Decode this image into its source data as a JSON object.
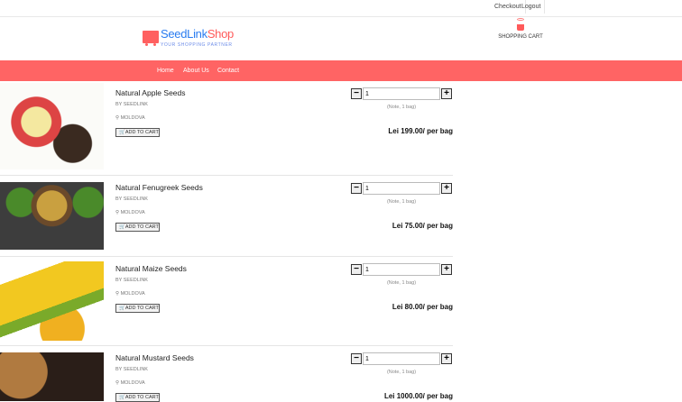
{
  "topbar": {
    "checkout": "Checkout",
    "logout": "Logout"
  },
  "brand": {
    "part1": "SeedLink",
    "part2": "Shop",
    "tagline": "YOUR SHOPPING PARTNER"
  },
  "cart": {
    "label": "SHOPPING CART"
  },
  "nav": [
    "Home",
    "About Us",
    "Contact"
  ],
  "colors": {
    "accent": "#ff6464",
    "brand_blue": "#2a7cf0"
  },
  "products": [
    {
      "name": "Natural Apple Seeds",
      "by": "BY SEEDLINK",
      "location": "MOLDOVA",
      "add": "ADD TO CART",
      "qty": "1",
      "note": "(Note, 1 bag)",
      "price": "Lei 199.00/ per bag"
    },
    {
      "name": "Natural Fenugreek Seeds",
      "by": "BY SEEDLINK",
      "location": "MOLDOVA",
      "add": "ADD TO CART",
      "qty": "1",
      "note": "(Note, 1 bag)",
      "price": "Lei 75.00/ per bag"
    },
    {
      "name": "Natural Maize Seeds",
      "by": "BY SEEDLINK",
      "location": "MOLDOVA",
      "add": "ADD TO CART",
      "qty": "1",
      "note": "(Note, 1 bag)",
      "price": "Lei 80.00/ per bag"
    },
    {
      "name": "Natural Mustard Seeds",
      "by": "BY SEEDLINK",
      "location": "MOLDOVA",
      "add": "ADD TO CART",
      "qty": "1",
      "note": "(Note, 1 bag)",
      "price": "Lei 1000.00/ per bag"
    }
  ]
}
